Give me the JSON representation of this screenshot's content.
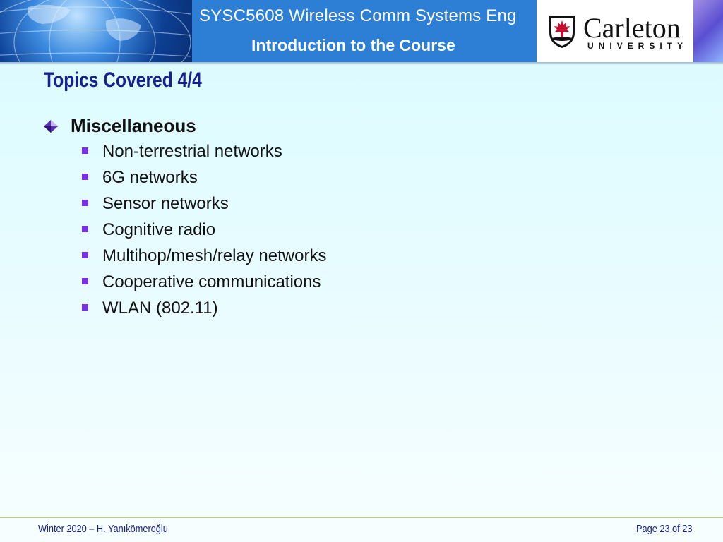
{
  "header": {
    "course_title": "SYSC5608 Wireless Comm Systems Eng",
    "course_subtitle": "Introduction to the Course",
    "logo": {
      "wordmark": "Carleton",
      "sub": "UNIVERSITY",
      "accent_color": "#c8102e"
    }
  },
  "slide": {
    "title": "Topics Covered 4/4",
    "level1": "Miscellaneous",
    "items": [
      "Non-terrestrial networks",
      "6G networks",
      "Sensor networks",
      "Cognitive radio",
      "Multihop/mesh/relay networks",
      "Cooperative communications",
      "WLAN (802.11)"
    ]
  },
  "footer": {
    "left": "Winter 2020 – H. Yanıkömeroğlu",
    "right": "Page 23 of 23"
  },
  "colors": {
    "title": "#17208c",
    "bullet": "#7b2ee8",
    "header_bg": "#2d7fd6",
    "footer_line": "#b8d06a"
  }
}
